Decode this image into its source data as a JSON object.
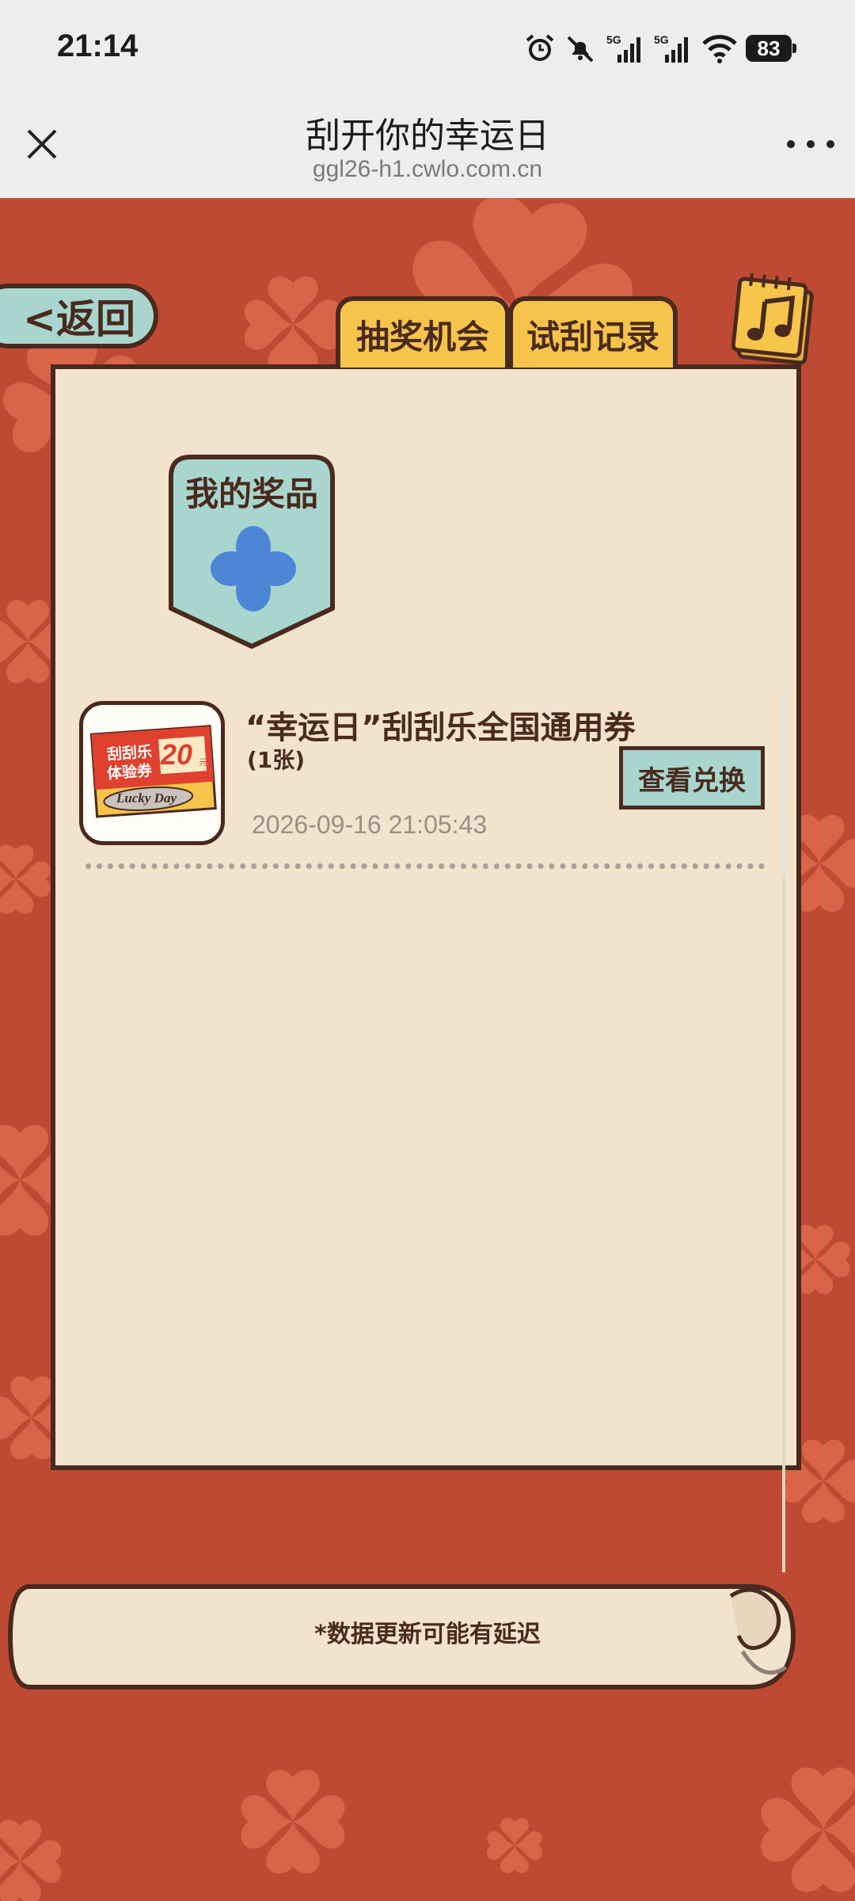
{
  "status_bar": {
    "time": "21:14",
    "icons": [
      "alarm-icon",
      "mute-icon",
      "signal-5g-icon",
      "signal-5g-icon",
      "wifi-icon"
    ],
    "battery": "83"
  },
  "browser": {
    "title": "刮开你的幸运日",
    "url": "ggl26-h1.cwlo.com.cn"
  },
  "top": {
    "back_label": "<返回"
  },
  "tabs": {
    "active": "我的奖品",
    "chance": "抽奖机会",
    "records": "试刮记录"
  },
  "prizes": [
    {
      "title": "“幸运日”刮刮乐全国通用券",
      "count": "(1张)",
      "date": "2026-09-16 21:05:43",
      "action": "查看兑换",
      "thumb": {
        "line1": "刮刮乐",
        "line2": "体验券",
        "amount": "20",
        "unit": "元",
        "tag": "Lucky Day"
      }
    }
  ],
  "footnote": "*数据更新可能有延迟",
  "colors": {
    "background": "#bf4a33",
    "clover": "#d96448",
    "paper": "#f2e3cc",
    "outline": "#4a2a1e",
    "teal": "#a8d6cf",
    "yellow": "#f6c44a",
    "blue_clover": "#4e86d6"
  }
}
